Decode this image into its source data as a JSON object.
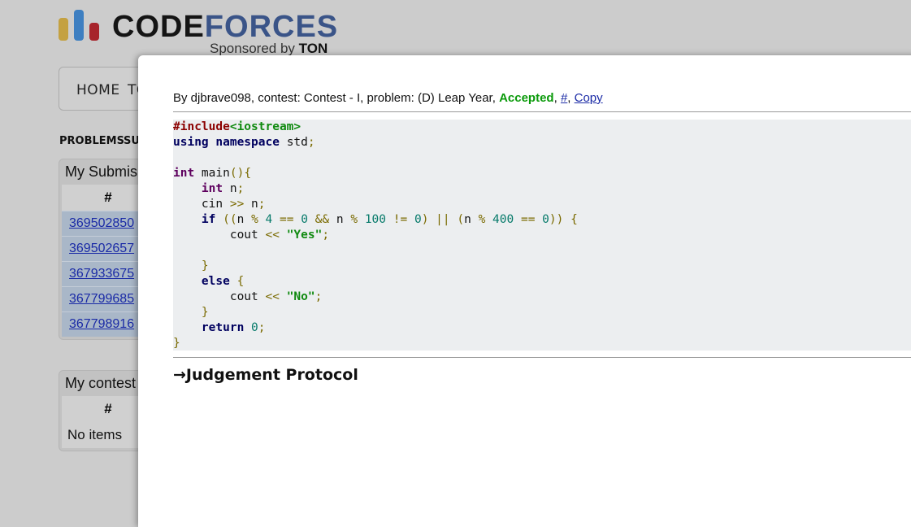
{
  "logo": {
    "code_text": "CODE",
    "forces_text": "FORCES",
    "sponsored_prefix": "Sponsored by",
    "sponsor_name": "TON",
    "colors": {
      "bar_yellow": "#c4a141",
      "bar_blue": "#3e7fc1",
      "bar_red": "#a7242b"
    }
  },
  "menu": {
    "home": "HOME",
    "next_partial": "TO"
  },
  "submenu": {
    "problems": "PROBLEMS",
    "sub_partial": "SUE"
  },
  "submissions_box": {
    "caption": "My Submis",
    "header": "#",
    "rows": [
      "369502850",
      "369502657",
      "367933675",
      "367799685",
      "367798916"
    ]
  },
  "contests_box": {
    "caption": "My contest",
    "header": "#",
    "empty_text": "No items"
  },
  "modal": {
    "header_prefix": "By djbrave098, contest: Contest - I, problem: (D) Leap Year,",
    "verdict": "Accepted",
    "separator": ",",
    "hash_link": "#",
    "copy_link": "Copy",
    "judgement_arrow": "→",
    "judgement_label": "Judgement Protocol",
    "accent_accepted": "#0a9a0a"
  },
  "code_lines": [
    [
      [
        "pp",
        "#include"
      ],
      [
        "inc",
        "<iostream>"
      ]
    ],
    [
      [
        "kw",
        "using"
      ],
      [
        "id",
        " "
      ],
      [
        "kw",
        "namespace"
      ],
      [
        "id",
        " std"
      ],
      [
        "pun",
        ";"
      ]
    ],
    [],
    [
      [
        "type",
        "int"
      ],
      [
        "id",
        " main"
      ],
      [
        "pun",
        "(){"
      ]
    ],
    [
      [
        "id",
        "    "
      ],
      [
        "type",
        "int"
      ],
      [
        "id",
        " n"
      ],
      [
        "pun",
        ";"
      ]
    ],
    [
      [
        "id",
        "    cin "
      ],
      [
        "pun",
        ">>"
      ],
      [
        "id",
        " n"
      ],
      [
        "pun",
        ";"
      ]
    ],
    [
      [
        "id",
        "    "
      ],
      [
        "kw",
        "if"
      ],
      [
        "id",
        " "
      ],
      [
        "pun",
        "(("
      ],
      [
        "id",
        "n "
      ],
      [
        "pun",
        "%"
      ],
      [
        "id",
        " "
      ],
      [
        "num",
        "4"
      ],
      [
        "id",
        " "
      ],
      [
        "pun",
        "=="
      ],
      [
        "id",
        " "
      ],
      [
        "num",
        "0"
      ],
      [
        "id",
        " "
      ],
      [
        "pun",
        "&&"
      ],
      [
        "id",
        " n "
      ],
      [
        "pun",
        "%"
      ],
      [
        "id",
        " "
      ],
      [
        "num",
        "100"
      ],
      [
        "id",
        " "
      ],
      [
        "pun",
        "!="
      ],
      [
        "id",
        " "
      ],
      [
        "num",
        "0"
      ],
      [
        "pun",
        ")"
      ],
      [
        "id",
        " "
      ],
      [
        "pun",
        "||"
      ],
      [
        "id",
        " "
      ],
      [
        "pun",
        "("
      ],
      [
        "id",
        "n "
      ],
      [
        "pun",
        "%"
      ],
      [
        "id",
        " "
      ],
      [
        "num",
        "400"
      ],
      [
        "id",
        " "
      ],
      [
        "pun",
        "=="
      ],
      [
        "id",
        " "
      ],
      [
        "num",
        "0"
      ],
      [
        "pun",
        "))"
      ],
      [
        "id",
        " "
      ],
      [
        "pun",
        "{"
      ]
    ],
    [
      [
        "id",
        "        cout "
      ],
      [
        "pun",
        "<<"
      ],
      [
        "id",
        " "
      ],
      [
        "str",
        "\"Yes\""
      ],
      [
        "pun",
        ";"
      ]
    ],
    [],
    [
      [
        "id",
        "    "
      ],
      [
        "pun",
        "}"
      ]
    ],
    [
      [
        "id",
        "    "
      ],
      [
        "kw",
        "else"
      ],
      [
        "id",
        " "
      ],
      [
        "pun",
        "{"
      ]
    ],
    [
      [
        "id",
        "        cout "
      ],
      [
        "pun",
        "<<"
      ],
      [
        "id",
        " "
      ],
      [
        "str",
        "\"No\""
      ],
      [
        "pun",
        ";"
      ]
    ],
    [
      [
        "id",
        "    "
      ],
      [
        "pun",
        "}"
      ]
    ],
    [
      [
        "id",
        "    "
      ],
      [
        "kw",
        "return"
      ],
      [
        "id",
        " "
      ],
      [
        "num",
        "0"
      ],
      [
        "pun",
        ";"
      ]
    ],
    [
      [
        "pun",
        "}"
      ]
    ]
  ]
}
